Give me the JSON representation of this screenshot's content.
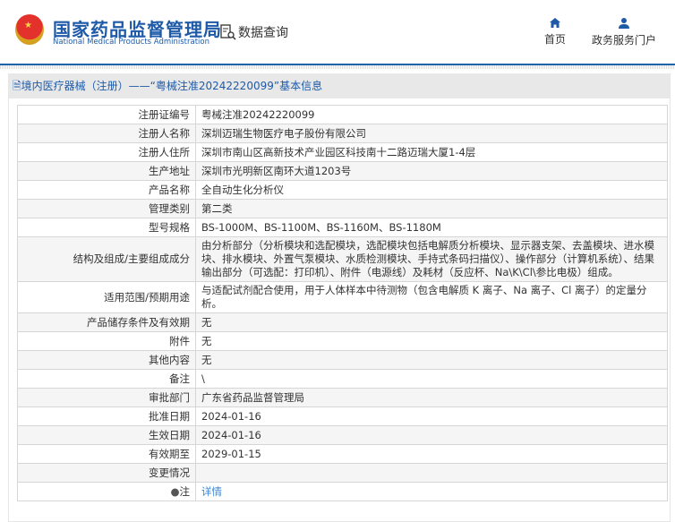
{
  "header": {
    "logo_cn": "国家药品监督管理局",
    "logo_en": "National Medical Products Administration",
    "data_query": "数据查询",
    "nav": [
      {
        "label": "首页",
        "icon": "home-icon"
      },
      {
        "label": "政务服务门户",
        "icon": "user-icon"
      }
    ]
  },
  "title": "境内医疗器械（注册）——“粤械注准20242220099”基本信息",
  "rows": [
    {
      "label": "注册证编号",
      "value": "粤械注准20242220099"
    },
    {
      "label": "注册人名称",
      "value": "深圳迈瑞生物医疗电子股份有限公司"
    },
    {
      "label": "注册人住所",
      "value": "深圳市南山区高新技术产业园区科技南十二路迈瑞大厦1-4层"
    },
    {
      "label": "生产地址",
      "value": "深圳市光明新区南环大道1203号"
    },
    {
      "label": "产品名称",
      "value": "全自动生化分析仪"
    },
    {
      "label": "管理类别",
      "value": "第二类"
    },
    {
      "label": "型号规格",
      "value": "BS-1000M、BS-1100M、BS-1160M、BS-1180M"
    },
    {
      "label": "结构及组成/主要组成成分",
      "value": "由分析部分（分析模块和选配模块，选配模块包括电解质分析模块、显示器支架、去盖模块、进水模块、排水模块、外置气泵模块、水质检测模块、手持式条码扫描仪）、操作部分（计算机系统）、结果输出部分（可选配：打印机）、附件（电源线）及耗材（反应杯、Na\\K\\Cl\\参比电极）组成。"
    },
    {
      "label": "适用范围/预期用途",
      "value": "与适配试剂配合使用，用于人体样本中待测物（包含电解质 K 离子、Na 离子、Cl 离子）的定量分析。"
    },
    {
      "label": "产品储存条件及有效期",
      "value": "无"
    },
    {
      "label": "附件",
      "value": "无"
    },
    {
      "label": "其他内容",
      "value": "无"
    },
    {
      "label": "备注",
      "value": "\\"
    },
    {
      "label": "审批部门",
      "value": "广东省药品监督管理局"
    },
    {
      "label": "批准日期",
      "value": "2024-01-16"
    },
    {
      "label": "生效日期",
      "value": "2024-01-16"
    },
    {
      "label": "有效期至",
      "value": "2029-01-15"
    },
    {
      "label": "变更情况",
      "value": ""
    }
  ],
  "note": {
    "label": "注",
    "link": "详情"
  }
}
